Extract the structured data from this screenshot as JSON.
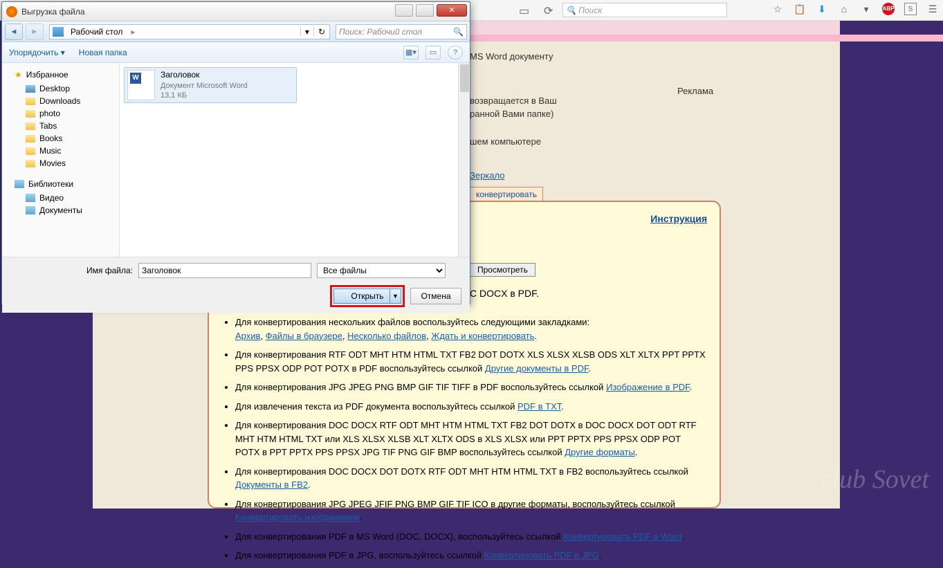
{
  "browser": {
    "search_placeholder": "Поиск",
    "icons": [
      "star",
      "clipboard",
      "download",
      "home",
      "pocket",
      "abp",
      "readability",
      "hamburger"
    ]
  },
  "site": {
    "top_line": "MS Word документу",
    "line1": "возвращается в Ваш",
    "line2": "ранной Вами папке)",
    "line3": "шем компьютере",
    "mirror_link": "Зеркало",
    "ad_label": "Реклама",
    "convert_tab": "конвертировать",
    "instruction_link": "Инструкция",
    "view_button": "Просмотреть",
    "docx_line": "C DOCX в PDF.",
    "bullets": [
      {
        "text": "Для конвертирования нескольких файлов воспользуйтесь следующими закладками:",
        "links": [
          "Архив",
          "Файлы в браузере",
          "Несколько файлов",
          "Ждать и конвертировать"
        ],
        "suffix": "."
      },
      {
        "text": "Для конвертирования RTF ODT MHT HTM HTML TXT FB2 DOT DOTX XLS XLSX XLSB ODS XLT XLTX PPT PPTX PPS PPSX ODP POT POTX в PDF воспользуйтесь ссылкой ",
        "links": [
          "Другие документы в PDF"
        ],
        "suffix": "."
      },
      {
        "text": "Для конвертирования JPG JPEG PNG BMP GIF TIF TIFF в PDF воспользуйтесь ссылкой ",
        "links": [
          "Изображение в PDF"
        ],
        "suffix": "."
      },
      {
        "text": "Для извлечения текста из PDF документа воспользуйтесь ссылкой ",
        "links": [
          "PDF в TXT"
        ],
        "suffix": "."
      },
      {
        "text": "Для конвертирования DOC DOCX RTF ODT MHT HTM HTML TXT FB2 DOT DOTX в DOC DOCX DOT ODT RTF MHT HTM HTML TXT или XLS XLSX XLSB XLT XLTX ODS в XLS XLSX или PPT PPTX PPS PPSX ODP POT POTX в PPT PPTX PPS PPSX JPG TIF PNG GIF BMP воспользуйтесь ссылкой ",
        "links": [
          "Другие форматы"
        ],
        "suffix": "."
      },
      {
        "text": "Для конвертирования DOC DOCX DOT DOTX RTF ODT MHT HTM HTML TXT в FB2 воспользуйтесь ссылкой ",
        "links": [
          "Документы в FB2"
        ],
        "suffix": "."
      },
      {
        "text": "Для конвертирования JPG JPEG JFIF PNG BMP GIF TIF ICO в другие форматы, воспользуйтесь ссылкой ",
        "links": [
          "Конвертировать изображение"
        ],
        "suffix": "."
      },
      {
        "text": "Для конвертирования PDF в MS Word (DOC, DOCX), воспользуйтесь ссылкой ",
        "links": [
          "Конвертировать PDF в Word"
        ],
        "suffix": "."
      },
      {
        "text": "Для конвертирования PDF в JPG, воспользуйтесь ссылкой ",
        "links": [
          "Конвертировать PDF в JPG"
        ],
        "suffix": "."
      }
    ]
  },
  "dialog": {
    "title": "Выгрузка файла",
    "breadcrumb_label": "Рабочий стол",
    "search_placeholder": "Поиск: Рабочий стол",
    "organize_label": "Упорядочить",
    "new_folder_label": "Новая папка",
    "sidebar": {
      "favorites": "Избранное",
      "fav_items": [
        "Desktop",
        "Downloads",
        "photo",
        "Tabs",
        "Books",
        "Music",
        "Movies"
      ],
      "libraries": "Библиотеки",
      "lib_items": [
        "Видео",
        "Документы"
      ]
    },
    "file": {
      "name": "Заголовок",
      "type": "Документ Microsoft Word",
      "size": "13,1 КБ"
    },
    "footer": {
      "filename_label": "Имя файла:",
      "filename_value": "Заголовок",
      "filetype_value": "Все файлы",
      "open_button": "Открыть",
      "cancel_button": "Отмена"
    }
  },
  "watermark": "club Sovet"
}
